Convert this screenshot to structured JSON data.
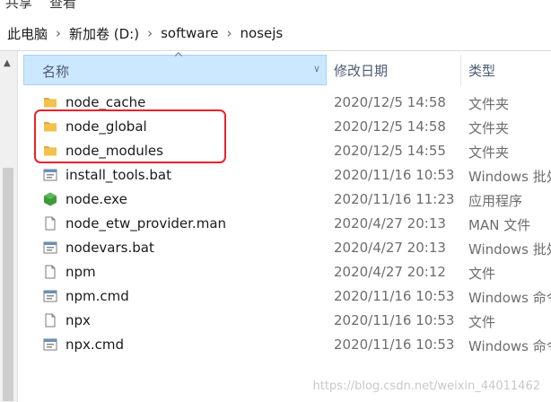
{
  "ribbon": {
    "items": [
      "共享",
      "查看"
    ]
  },
  "breadcrumb": [
    "此电脑",
    "新加卷 (D:)",
    "software",
    "nosejs"
  ],
  "columns": {
    "name": "名称",
    "date": "修改日期",
    "type": "类型"
  },
  "files": [
    {
      "name": "node_cache",
      "date": "2020/12/5 14:58",
      "type": "文件夹",
      "icon": "folder-icon"
    },
    {
      "name": "node_global",
      "date": "2020/12/5 14:58",
      "type": "文件夹",
      "icon": "folder-icon"
    },
    {
      "name": "node_modules",
      "date": "2020/12/5 14:55",
      "type": "文件夹",
      "icon": "folder-icon"
    },
    {
      "name": "install_tools.bat",
      "date": "2020/11/16 10:53",
      "type": "Windows 批处",
      "icon": "batch-file-icon"
    },
    {
      "name": "node.exe",
      "date": "2020/11/16 11:23",
      "type": "应用程序",
      "icon": "node-exe-icon"
    },
    {
      "name": "node_etw_provider.man",
      "date": "2020/4/27 20:13",
      "type": "MAN 文件",
      "icon": "document-icon"
    },
    {
      "name": "nodevars.bat",
      "date": "2020/4/27 20:13",
      "type": "Windows 批处",
      "icon": "batch-file-icon"
    },
    {
      "name": "npm",
      "date": "2020/4/27 20:12",
      "type": "文件",
      "icon": "document-icon"
    },
    {
      "name": "npm.cmd",
      "date": "2020/11/16 10:53",
      "type": "Windows 命令",
      "icon": "batch-file-icon"
    },
    {
      "name": "npx",
      "date": "2020/11/16 10:53",
      "type": "文件",
      "icon": "document-icon"
    },
    {
      "name": "npx.cmd",
      "date": "2020/11/16 10:53",
      "type": "Windows 命令",
      "icon": "batch-file-icon"
    }
  ],
  "watermark": "https://blog.csdn.net/weixin_44011462",
  "colors": {
    "highlight": "#e8232a",
    "folder": "#f2c14e",
    "selected_header": "#cce8ff",
    "node_green": "#3c9a3c"
  }
}
